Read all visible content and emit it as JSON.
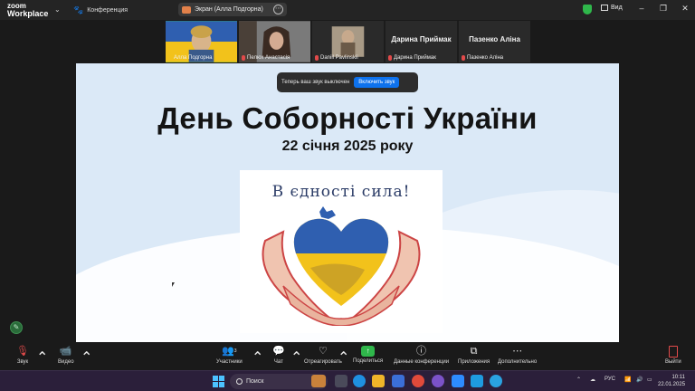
{
  "titlebar": {
    "logo_line1": "zoom",
    "logo_line2": "Workplace",
    "meeting_label": "Конференция",
    "share_label": "Экран (Алла Подгорна)",
    "view_label": "Вид"
  },
  "gallery": {
    "participants": [
      {
        "name": "Алла Подгорна",
        "active": true
      },
      {
        "name": "Пелюх Анастасія",
        "active": false
      },
      {
        "name": "Daniil Pavlinskii",
        "active": false
      },
      {
        "name": "Дарина Приймак",
        "active": false,
        "video_off": true
      },
      {
        "name": "Пазенко Аліна",
        "active": false,
        "video_off": true
      }
    ]
  },
  "notice": {
    "text": "Теперь ваш звук выключен",
    "button": "Включить звук"
  },
  "slide": {
    "title": "День Соборності України",
    "subtitle": "22 січня 2025 року",
    "motto": "В єдності сила!"
  },
  "toolbar": {
    "audio": "Звук",
    "video": "Видео",
    "participants": "Участники",
    "participants_count": "3",
    "chat": "Чат",
    "react": "Отреагировать",
    "share": "Поделиться",
    "info": "Данные конференции",
    "apps": "Приложения",
    "more": "Дополнительно",
    "leave": "Выйти"
  },
  "taskbar": {
    "search_placeholder": "Поиск",
    "lang": "РУС",
    "time": "10:11",
    "date": "22.01.2025"
  },
  "colors": {
    "accent_green": "#2fb74b",
    "zoom_blue": "#0e72ed",
    "mute_red": "#e24a4a",
    "flag_blue": "#2f5fb0",
    "flag_yellow": "#f2c21b"
  }
}
